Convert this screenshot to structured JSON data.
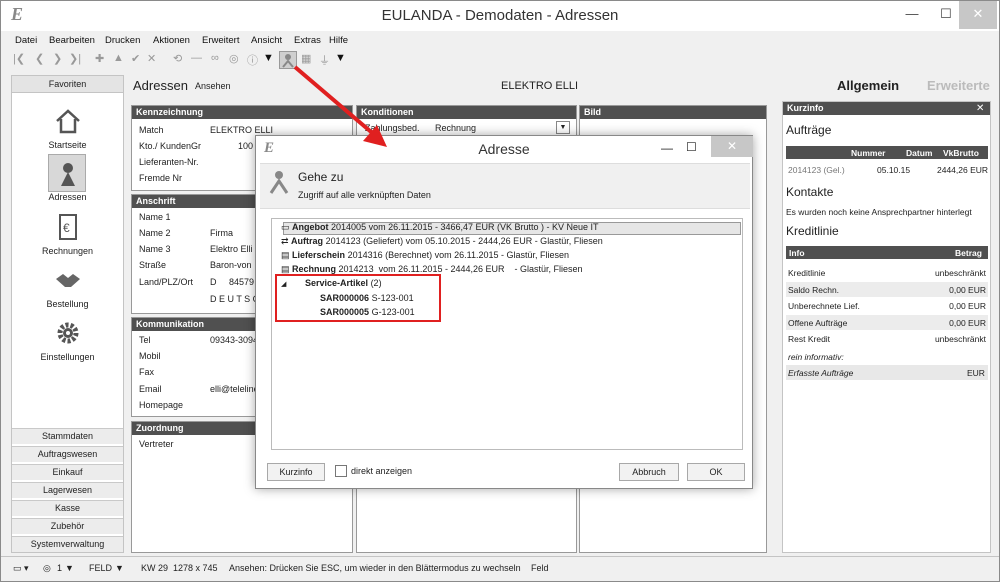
{
  "window": {
    "title": "EULANDA - Demodaten - Adressen",
    "logo": "E",
    "min": "—",
    "max": "☐",
    "close": "✕"
  },
  "menu": [
    "Datei",
    "Bearbeiten",
    "Drucken",
    "Aktionen",
    "Erweitert",
    "Ansicht",
    "Extras",
    "Hilfe"
  ],
  "sidebar": {
    "header": "Favoriten",
    "items": [
      "Startseite",
      "Adressen",
      "Rechnungen",
      "Bestellung",
      "Einstellungen"
    ],
    "groups": [
      "Stammdaten",
      "Auftragswesen",
      "Einkauf",
      "Lagerwesen",
      "Kasse",
      "Zubehör",
      "Systemverwaltung"
    ]
  },
  "main": {
    "title": "Adressen",
    "mode": "Ansehen",
    "record": "ELEKTRO ELLI",
    "tab_active": "Allgemein",
    "tab_inactive": "Erweiterte",
    "kennzeichnung": {
      "header": "Kennzeichnung",
      "rows": [
        {
          "label": "Match",
          "value": "ELEKTRO ELLI"
        },
        {
          "label": "Kto./ KundenGr",
          "value": "100"
        },
        {
          "label": "Lieferanten-Nr.",
          "value": ""
        },
        {
          "label": "Fremde Nr",
          "value": ""
        }
      ]
    },
    "anschrift": {
      "header": "Anschrift",
      "rows": [
        {
          "label": "Name 1",
          "value": ""
        },
        {
          "label": "Name 2",
          "value": "Firma"
        },
        {
          "label": "Name 3",
          "value": "Elektro Elli"
        },
        {
          "label": "Straße",
          "value": "Baron-von"
        },
        {
          "label": "Land/PLZ/Ort",
          "value": "D     84579"
        }
      ],
      "country": "D E U T S C"
    },
    "kommunikation": {
      "header": "Kommunikation",
      "rows": [
        {
          "label": "Tel",
          "value": "09343-3094"
        },
        {
          "label": "Mobil",
          "value": ""
        },
        {
          "label": "Fax",
          "value": ""
        },
        {
          "label": "Email",
          "value": "elli@teleline"
        },
        {
          "label": "Homepage",
          "value": ""
        }
      ]
    },
    "zuordnung": {
      "header": "Zuordnung",
      "rows": [
        {
          "label": "Vertreter",
          "value": ""
        }
      ]
    },
    "konditionen": {
      "header": "Konditionen",
      "label": "Zahlungsbed.",
      "value": "Rechnung"
    },
    "bild": {
      "header": "Bild"
    }
  },
  "kurzinfo": {
    "header": "Kurzinfo",
    "close": "✕",
    "auftraege": {
      "title": "Aufträge",
      "cols": [
        "Nummer",
        "Datum",
        "VkBrutto"
      ],
      "rows": [
        [
          "2014123 (Gel.)",
          "05.10.15",
          "2444,26 EUR"
        ]
      ]
    },
    "kontakte": {
      "title": "Kontakte",
      "text": "Es wurden noch keine Ansprechpartner hinterlegt"
    },
    "kreditlinie": {
      "title": "Kreditlinie",
      "cols": [
        "Info",
        "Betrag"
      ],
      "rows": [
        [
          "Kreditlinie",
          "unbeschränkt"
        ],
        [
          "Saldo Rechn.",
          "0,00 EUR"
        ],
        [
          "Unberechnete Lief.",
          "0,00 EUR"
        ],
        [
          "Offene Aufträge",
          "0,00 EUR"
        ],
        [
          "Rest Kredit",
          "unbeschränkt"
        ]
      ],
      "note": "rein informativ:",
      "extra": [
        "Erfasste Aufträge",
        "EUR"
      ]
    }
  },
  "status": {
    "kw": "KW 29",
    "res": "1278 x 745",
    "message": "Ansehen: Drücken Sie ESC, um wieder in den Blättermodus zu wechseln",
    "field": "Feld",
    "mode": "FELD",
    "num": "1"
  },
  "dialog": {
    "title": "Adresse",
    "heading": "Gehe zu",
    "subtitle": "Zugriff auf alle verknüpften Daten",
    "rows": [
      {
        "type": "Angebot",
        "text": "2014005 vom 26.11.2015 - 3466,47 EUR (VK Brutto ) - KV Neue IT"
      },
      {
        "type": "Auftrag",
        "text": "2014123 (Geliefert) vom 05.10.2015 - 2444,26 EUR - Glastür, Fliesen"
      },
      {
        "type": "Lieferschein",
        "text": "2014316 (Berechnet) vom 26.11.2015 - Glastür, Fliesen"
      },
      {
        "type": "Rechnung",
        "text": "2014213  vom 26.11.2015 - 2444,26 EUR    - Glastür, Fliesen"
      }
    ],
    "group": {
      "label": "Service-Artikel",
      "count": "(2)",
      "items": [
        {
          "id": "SAR000006",
          "sub": "S-123-001"
        },
        {
          "id": "SAR000005",
          "sub": "G-123-001"
        }
      ]
    },
    "buttons": {
      "kurzinfo": "Kurzinfo",
      "direct": "direkt anzeigen",
      "cancel": "Abbruch",
      "ok": "OK"
    }
  },
  "colors": {
    "accent_red": "#e02020",
    "panel_header": "#505050"
  }
}
